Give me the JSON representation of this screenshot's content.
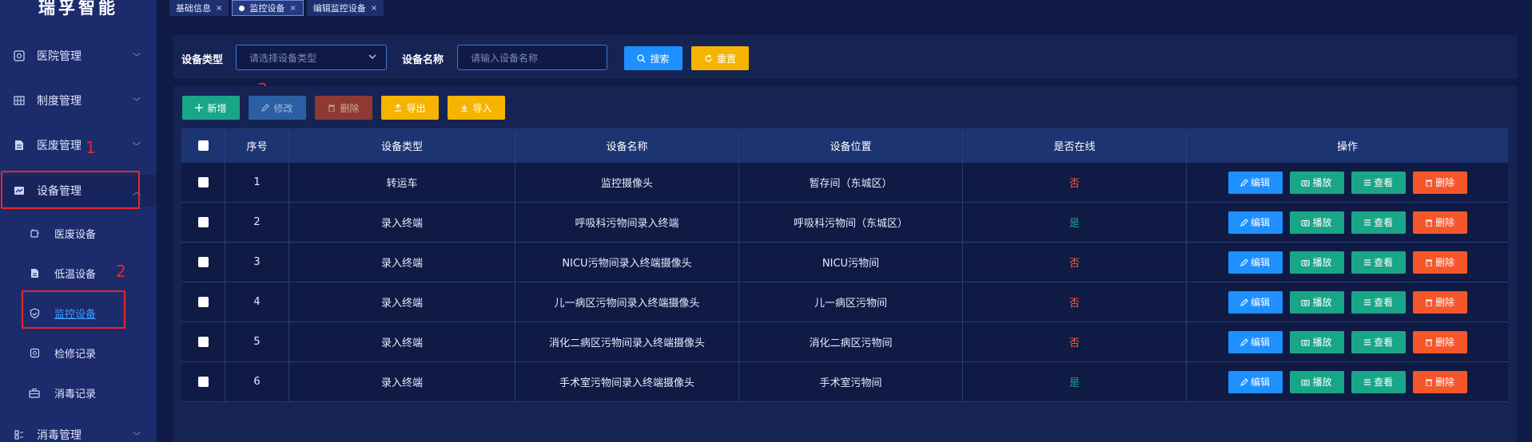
{
  "app": {
    "logo": "瑞孚智能"
  },
  "sidebar": {
    "items": [
      {
        "label": "医院管理",
        "icon": "hospital-icon"
      },
      {
        "label": "制度管理",
        "icon": "grid-icon"
      },
      {
        "label": "医废管理",
        "icon": "document-icon"
      },
      {
        "label": "设备管理",
        "icon": "device-icon"
      },
      {
        "label": "消毒管理",
        "icon": "disinfect-icon"
      }
    ],
    "subitems": [
      {
        "label": "医废设备",
        "icon": "waste-device-icon"
      },
      {
        "label": "低温设备",
        "icon": "cold-device-icon"
      },
      {
        "label": "监控设备",
        "icon": "shield-icon"
      },
      {
        "label": "检修记录",
        "icon": "repair-icon"
      },
      {
        "label": "消毒记录",
        "icon": "briefcase-icon"
      }
    ]
  },
  "annotations": {
    "n1": "1",
    "n2": "2",
    "n3": "3"
  },
  "tabs": [
    {
      "label": "基础信息",
      "close": "×"
    },
    {
      "label": "监控设备",
      "close": "×"
    },
    {
      "label": "编辑监控设备",
      "close": "×"
    }
  ],
  "search": {
    "type_label": "设备类型",
    "type_placeholder": "请选择设备类型",
    "name_label": "设备名称",
    "name_placeholder": "请输入设备名称",
    "search_btn": "搜索",
    "reset_btn": "重置"
  },
  "toolbar": {
    "add": "新增",
    "edit": "修改",
    "delete": "删除",
    "export": "导出",
    "import": "导入"
  },
  "table": {
    "headers": [
      "序号",
      "设备类型",
      "设备名称",
      "设备位置",
      "是否在线",
      "操作"
    ],
    "rows": [
      {
        "no": "1",
        "type": "转运车",
        "name": "监控摄像头",
        "location": "暂存间（东城区）",
        "online": "否"
      },
      {
        "no": "2",
        "type": "录入终端",
        "name": "呼吸科污物间录入终端",
        "location": "呼吸科污物间（东城区）",
        "online": "是"
      },
      {
        "no": "3",
        "type": "录入终端",
        "name": "NICU污物间录入终端摄像头",
        "location": "NICU污物间",
        "online": "否"
      },
      {
        "no": "4",
        "type": "录入终端",
        "name": "儿一病区污物间录入终端摄像头",
        "location": "儿一病区污物间",
        "online": "否"
      },
      {
        "no": "5",
        "type": "录入终端",
        "name": "消化二病区污物间录入终端摄像头",
        "location": "消化二病区污物间",
        "online": "否"
      },
      {
        "no": "6",
        "type": "录入终端",
        "name": "手术室污物间录入终端摄像头",
        "location": "手术室污物间",
        "online": "是"
      }
    ],
    "actions": {
      "edit": "编辑",
      "play": "播放",
      "view": "查看",
      "delete": "删除"
    }
  },
  "colors": {
    "accent": "#1e90ff",
    "warning": "#f5b400",
    "success": "#19a688",
    "danger": "#f5572a",
    "annotation": "#e8262a"
  }
}
